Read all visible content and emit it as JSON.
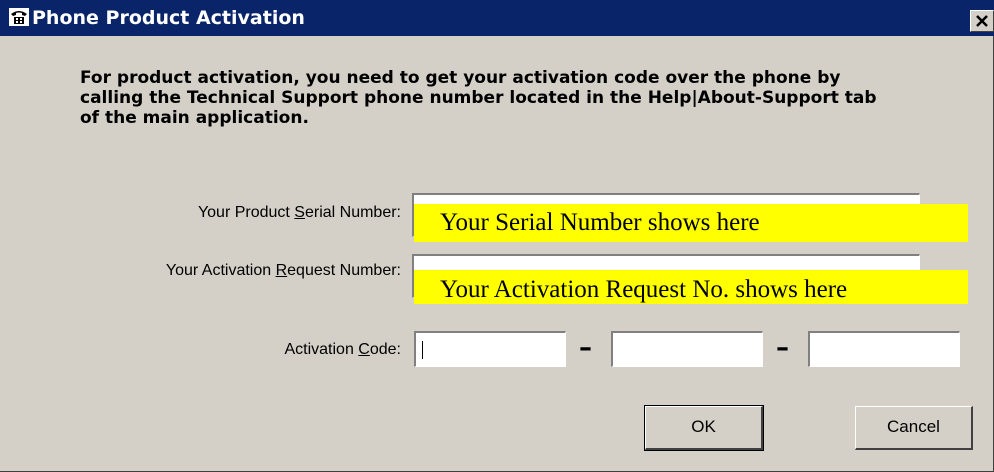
{
  "window": {
    "title": "Phone Product Activation"
  },
  "instructions": "For product activation, you need to get your activation code over the phone by calling the Technical Support phone number located in the Help|About-Support tab of the main application.",
  "fields": {
    "serial": {
      "label_before": "Your Product ",
      "label_mnemonic": "S",
      "label_after": "erial Number:",
      "overlay_text": "Your Serial Number shows here"
    },
    "request": {
      "label_before": "Your Activation ",
      "label_mnemonic": "R",
      "label_after": "equest Number:",
      "overlay_text": "Your Activation Request No. shows here"
    },
    "code": {
      "label_before": "Activation ",
      "label_mnemonic": "C",
      "label_after": "ode:",
      "separator": "–",
      "values": [
        "",
        "",
        ""
      ]
    }
  },
  "buttons": {
    "ok": "OK",
    "cancel": "Cancel"
  },
  "colors": {
    "title_bar": "#0a246a",
    "window_bg": "#d4d0c8",
    "highlight": "#ffff00"
  },
  "icons": {
    "title": "telephone-icon",
    "close": "close-icon"
  }
}
